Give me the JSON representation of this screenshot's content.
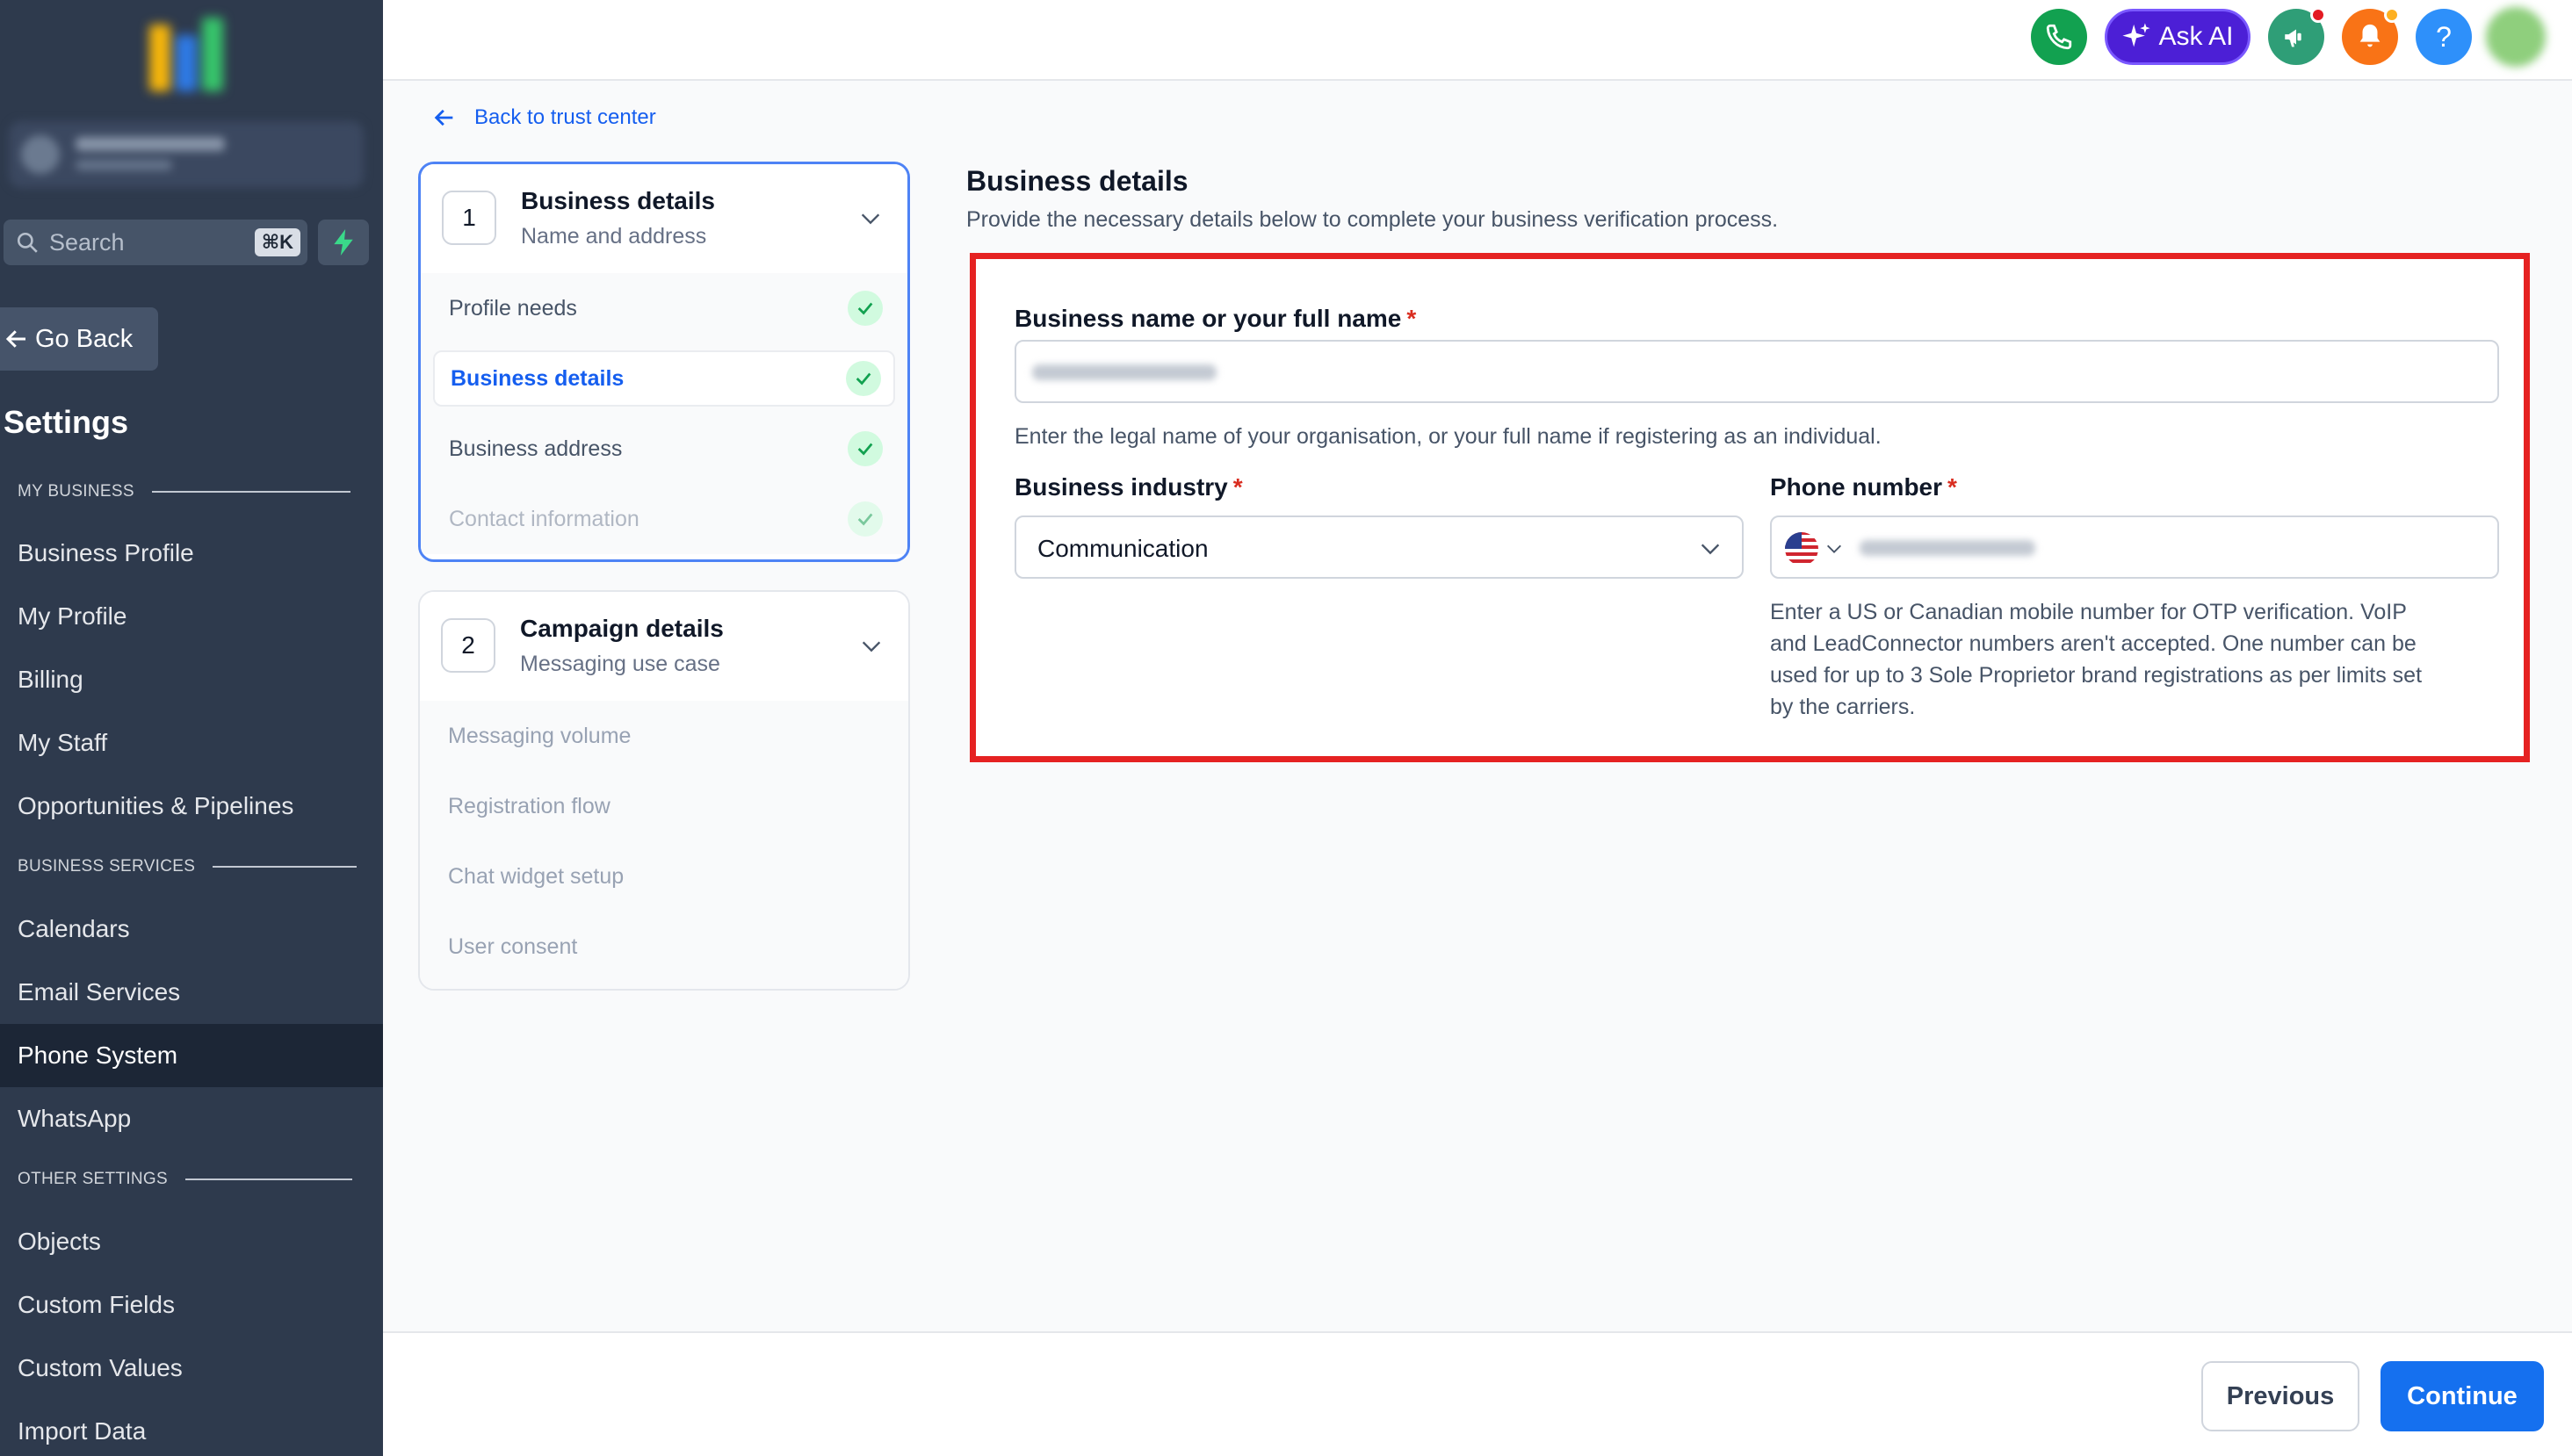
{
  "sidebar": {
    "search": {
      "placeholder": "Search",
      "shortcut": "⌘K"
    },
    "go_back": "Go Back",
    "title": "Settings",
    "sections": {
      "my_business": "MY BUSINESS",
      "business_services": "BUSINESS SERVICES",
      "other_settings": "OTHER SETTINGS"
    },
    "items": [
      "Business Profile",
      "My Profile",
      "Billing",
      "My Staff",
      "Opportunities & Pipelines",
      "Calendars",
      "Email Services",
      "Phone System",
      "WhatsApp",
      "Objects",
      "Custom Fields",
      "Custom Values",
      "Import Data"
    ],
    "active_item": "Phone System"
  },
  "topbar": {
    "ask_ai": "Ask AI",
    "help_symbol": "?",
    "icons": [
      "phone-icon",
      "sparkle-icon",
      "megaphone-icon",
      "bell-icon",
      "help-icon",
      "avatar"
    ],
    "colors": {
      "phone": "#12a150",
      "ask_ai": "#4c1fd6",
      "megaphone": "#2f9e77",
      "bell": "#f97316",
      "help": "#2e90fa"
    }
  },
  "main": {
    "back_link": "Back to trust center",
    "steps": [
      {
        "number": "1",
        "title": "Business details",
        "subtitle": "Name and address",
        "items": [
          {
            "label": "Profile needs",
            "done": true
          },
          {
            "label": "Business details",
            "done": true,
            "current": true
          },
          {
            "label": "Business address",
            "done": true
          },
          {
            "label": "Contact information",
            "done": true
          }
        ]
      },
      {
        "number": "2",
        "title": "Campaign details",
        "subtitle": "Messaging use case",
        "items": [
          {
            "label": "Messaging volume"
          },
          {
            "label": "Registration flow"
          },
          {
            "label": "Chat widget setup"
          },
          {
            "label": "User consent"
          }
        ]
      }
    ],
    "form": {
      "title": "Business details",
      "subtitle": "Provide the necessary details below to complete your business verification process.",
      "business_name_label": "Business name or your full name",
      "business_name_help": "Enter the legal name of your organisation, or your full name if registering as an individual.",
      "industry_label": "Business industry",
      "industry_value": "Communication",
      "phone_label": "Phone number",
      "phone_country": "US",
      "phone_help_lines": [
        "Enter a US or Canadian mobile number for OTP verification. VoIP",
        "and LeadConnector numbers aren't accepted. One number can be",
        "used for up to 3 Sole Proprietor brand registrations as per limits set",
        "by the carriers."
      ],
      "required_mark": "*"
    }
  },
  "footer": {
    "previous": "Previous",
    "continue": "Continue"
  }
}
